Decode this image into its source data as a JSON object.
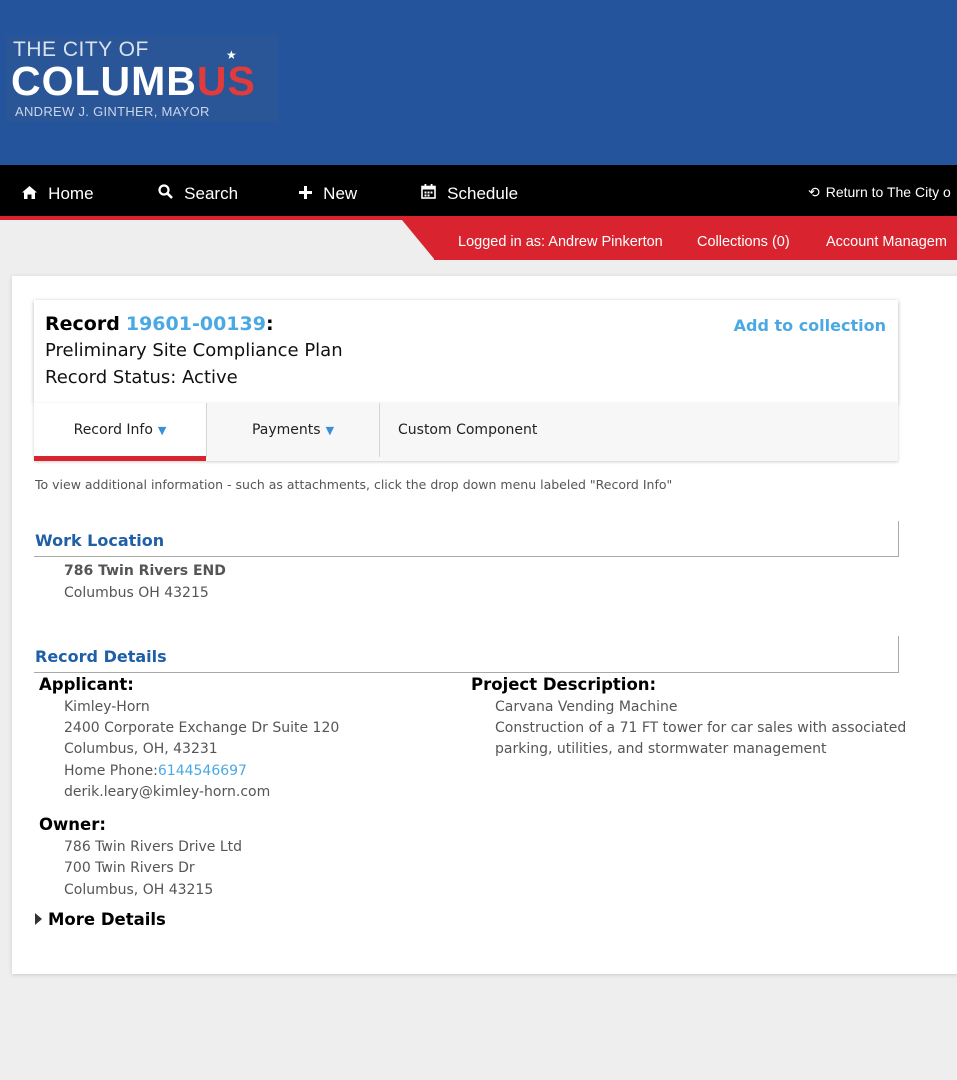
{
  "logo": {
    "line1": "THE CITY OF",
    "line2_main": "COLUMB",
    "line2_accent": "US",
    "line3": "ANDREW J. GINTHER, MAYOR"
  },
  "nav": {
    "home": "Home",
    "search": "Search",
    "new": "New",
    "schedule": "Schedule",
    "return": "Return to The City o"
  },
  "userbar": {
    "logged_in": "Logged in as: Andrew Pinkerton",
    "collections": "Collections (0)",
    "account": "Account Managem"
  },
  "record": {
    "label": "Record",
    "number": "19601-00139",
    "colon": ":",
    "type": "Preliminary Site Compliance Plan",
    "status": "Record Status: Active",
    "add_to_collection": "Add to collection"
  },
  "tabs": {
    "record_info": "Record Info",
    "payments": "Payments",
    "custom": "Custom Component"
  },
  "hint": "To view additional information - such as attachments, click the drop down menu labeled \"Record Info\"",
  "work_location": {
    "title": "Work Location",
    "address1": "786 Twin Rivers END",
    "address2": "Columbus OH 43215"
  },
  "record_details": {
    "title": "Record Details",
    "applicant_label": "Applicant:",
    "applicant_name": "Kimley-Horn",
    "applicant_addr1": "2400 Corporate Exchange Dr Suite 120",
    "applicant_addr2": "Columbus, OH, 43231",
    "home_phone_label": "Home Phone:",
    "home_phone": "6144546697",
    "email": "derik.leary@kimley-horn.com",
    "project_label": "Project Description:",
    "project_name": "Carvana Vending Machine",
    "project_desc1": "Construction of a 71 FT tower for car sales with associated",
    "project_desc2": "parking, utilities, and stormwater management",
    "owner_label": "Owner:",
    "owner_name": "786 Twin Rivers Drive Ltd",
    "owner_addr1": "700 Twin Rivers Dr",
    "owner_addr2": "Columbus, OH 43215",
    "more_details": "More Details"
  }
}
